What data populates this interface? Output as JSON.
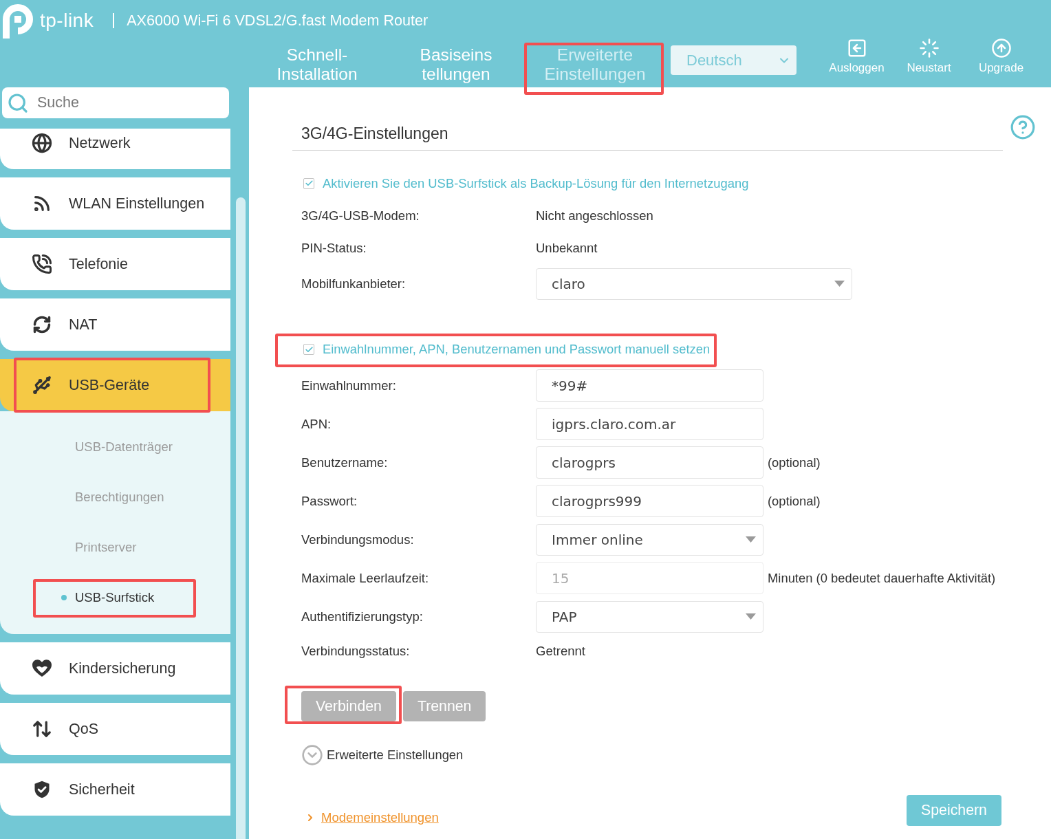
{
  "header": {
    "logo": "tp-link",
    "product": "AX6000 Wi-Fi 6 VDSL2/G.fast Modem Router",
    "tabs": [
      {
        "label": "Schnell-\nInstallation",
        "selected": false,
        "highlighted": false
      },
      {
        "label": "Basiseins\ntellungen",
        "selected": false,
        "highlighted": false
      },
      {
        "label": "Erweiterte\nEinstellungen",
        "selected": true,
        "highlighted": true
      }
    ],
    "language": {
      "value": "Deutsch"
    },
    "actions": [
      {
        "label": "Ausloggen"
      },
      {
        "label": "Neustart"
      },
      {
        "label": "Upgrade"
      }
    ]
  },
  "sidebar": {
    "search": {
      "placeholder": "Suche"
    },
    "items": [
      {
        "label": "Netzwerk",
        "selected": false,
        "highlighted": false
      },
      {
        "label": "WLAN Einstellungen",
        "selected": false,
        "highlighted": false
      },
      {
        "label": "Telefonie",
        "selected": false,
        "highlighted": false
      },
      {
        "label": "NAT",
        "selected": false,
        "highlighted": false
      },
      {
        "label": "USB-Geräte",
        "selected": true,
        "highlighted": true,
        "children": [
          {
            "label": "USB-Datenträger",
            "selected": false,
            "highlighted": false
          },
          {
            "label": "Berechtigungen",
            "selected": false,
            "highlighted": false
          },
          {
            "label": "Printserver",
            "selected": false,
            "highlighted": false
          },
          {
            "label": "USB-Surfstick",
            "selected": true,
            "highlighted": true
          }
        ]
      },
      {
        "label": "Kindersicherung",
        "selected": false,
        "highlighted": false
      },
      {
        "label": "QoS",
        "selected": false,
        "highlighted": false
      },
      {
        "label": "Sicherheit",
        "selected": false,
        "highlighted": false
      }
    ]
  },
  "content": {
    "title": "3G/4G-Einstellungen",
    "general": [
      {
        "kind": "checkbox",
        "label": "Aktivieren Sie den USB-Surfstick als Backup-Lösung für den Internetzugang",
        "checked": true,
        "highlighted": false
      },
      {
        "kind": "info",
        "label": "3G/4G-USB-Modem:",
        "value": "Nicht angeschlossen"
      },
      {
        "kind": "info",
        "label": "PIN-Status:",
        "value": "Unbekannt"
      },
      {
        "kind": "select",
        "label": "Mobilfunkanbieter:",
        "value": "claro"
      }
    ],
    "manual": [
      {
        "kind": "checkbox",
        "label": "Einwahlnummer, APN, Benutzernamen und Passwort manuell setzen",
        "checked": true,
        "highlighted": true
      },
      {
        "kind": "input",
        "label": "Einwahlnummer:",
        "value": "*99#",
        "disabled": false
      },
      {
        "kind": "input",
        "label": "APN:",
        "value": "igprs.claro.com.ar",
        "disabled": false
      },
      {
        "kind": "input",
        "label": "Benutzername:",
        "value": "clarogprs",
        "disabled": false,
        "suffix": "(optional)"
      },
      {
        "kind": "input",
        "label": "Passwort:",
        "value": "clarogprs999",
        "disabled": false,
        "suffix": "(optional)"
      },
      {
        "kind": "select",
        "label": "Verbindungsmodus:",
        "value": "Immer online"
      },
      {
        "kind": "input",
        "label": "Maximale Leerlaufzeit:",
        "value": "15",
        "disabled": true,
        "suffix": "Minuten (0 bedeutet dauerhafte Aktivität)"
      },
      {
        "kind": "select",
        "label": "Authentifizierungstyp:",
        "value": "PAP"
      },
      {
        "kind": "info",
        "label": "Verbindungsstatus:",
        "value": "Getrennt"
      }
    ],
    "buttons": [
      {
        "label": "Verbinden",
        "disabled": true,
        "highlighted": true
      },
      {
        "label": "Trennen",
        "disabled": true,
        "highlighted": false
      }
    ],
    "advanced": {
      "label": "Erweiterte Einstellungen",
      "expanded": false
    },
    "link": {
      "label": "Modemeinstellungen"
    },
    "save": {
      "label": "Speichern"
    }
  }
}
